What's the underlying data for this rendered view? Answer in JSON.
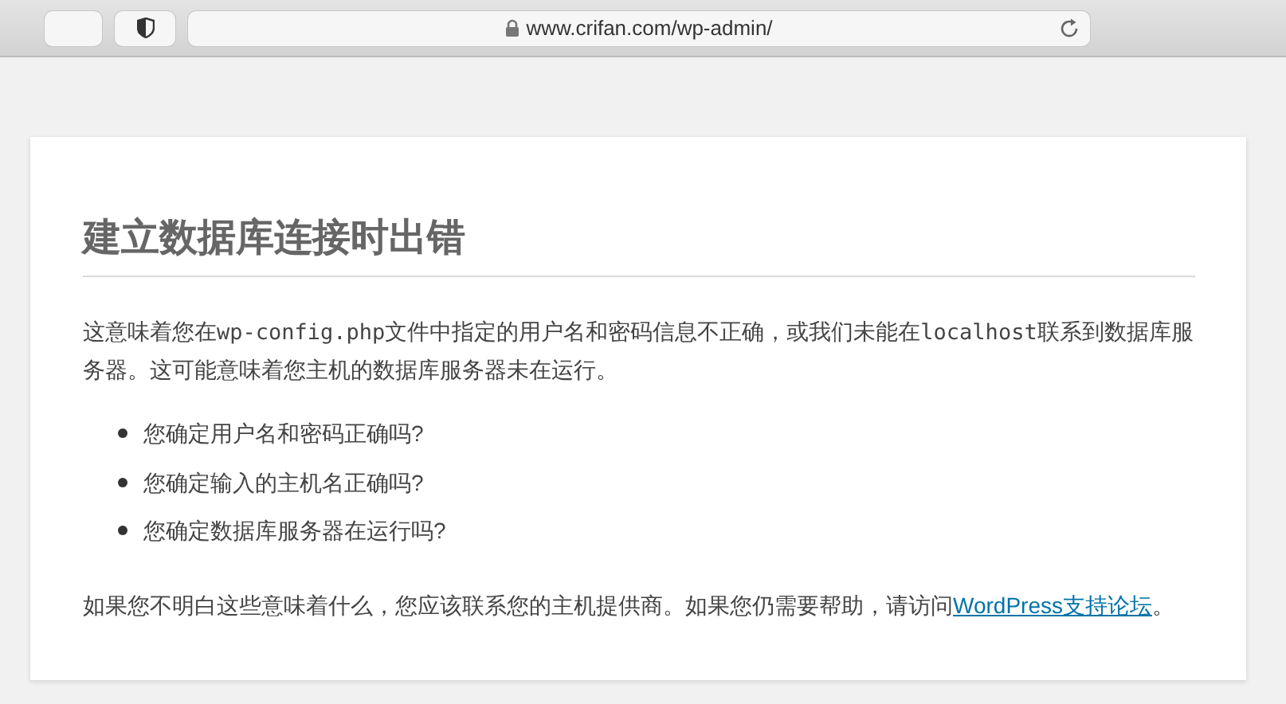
{
  "browser": {
    "url": "www.crifan.com/wp-admin/"
  },
  "error": {
    "title": "建立数据库连接时出错",
    "intro": [
      {
        "kind": "text",
        "text": "这意味着您在"
      },
      {
        "kind": "code",
        "text": "wp-config.php"
      },
      {
        "kind": "text",
        "text": "文件中指定的用户名和密码信息不正确，或我们未能在"
      },
      {
        "kind": "code",
        "text": "localhost"
      },
      {
        "kind": "text",
        "text": "联系到数据库服务器。这可能意味着您主机的数据库服务器未在运行。"
      }
    ],
    "checks": [
      "您确定用户名和密码正确吗?",
      "您确定输入的主机名正确吗?",
      "您确定数据库服务器在运行吗?"
    ],
    "help": [
      {
        "kind": "text",
        "text": "如果您不明白这些意味着什么，您应该联系您的主机提供商。如果您仍需要帮助，请访问"
      },
      {
        "kind": "link",
        "text": "WordPress支持论坛"
      },
      {
        "kind": "text",
        "text": "。"
      }
    ]
  }
}
